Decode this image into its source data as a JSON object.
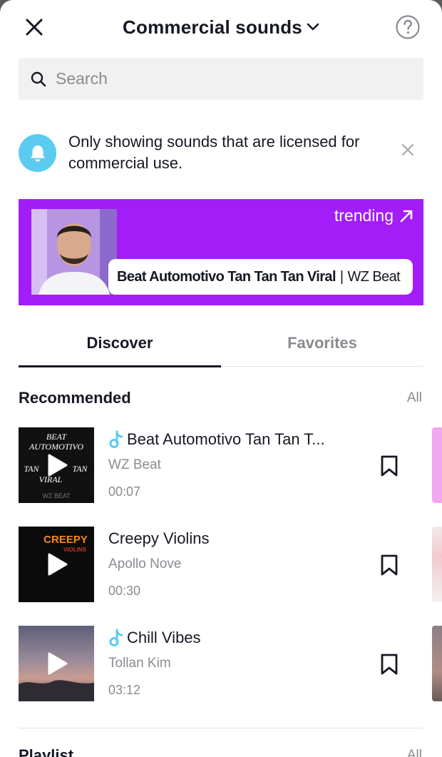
{
  "header": {
    "title": "Commercial sounds",
    "close_icon": "close-icon",
    "help_icon": "help-circle-icon"
  },
  "search": {
    "placeholder": "Search"
  },
  "notice": {
    "text": "Only showing sounds that are licensed for commercial use."
  },
  "banner": {
    "trending_label": "trending",
    "song_title": "Beat Automotivo Tan Tan Tan Viral",
    "separator": "|",
    "artist": "WZ Beat",
    "background_color": "#a21df7"
  },
  "tabs": [
    {
      "label": "Discover",
      "active": true
    },
    {
      "label": "Favorites",
      "active": false
    }
  ],
  "recommended": {
    "title": "Recommended",
    "all_label": "All",
    "items": [
      {
        "title": "Beat Automotivo Tan Tan T...",
        "artist": "WZ Beat",
        "duration": "00:07",
        "has_note_icon": true,
        "cover_text": [
          "BEAT",
          "AUTOMOTIVO",
          "TAN",
          "TAN",
          "VIRAL",
          "WZ BEAT"
        ]
      },
      {
        "title": "Creepy Violins",
        "artist": "Apollo Nove",
        "duration": "00:30",
        "has_note_icon": false,
        "cover_text": [
          "CREEPY",
          "VIOLINS"
        ]
      },
      {
        "title": "Chill Vibes",
        "artist": "Tollan Kim",
        "duration": "03:12",
        "has_note_icon": true
      }
    ]
  },
  "playlist": {
    "title": "Playlist",
    "all_label": "All"
  },
  "colors": {
    "accent_purple": "#a21df7",
    "bell_blue": "#5bcbf0",
    "text_primary": "#161823",
    "text_secondary": "#8a8b91"
  }
}
